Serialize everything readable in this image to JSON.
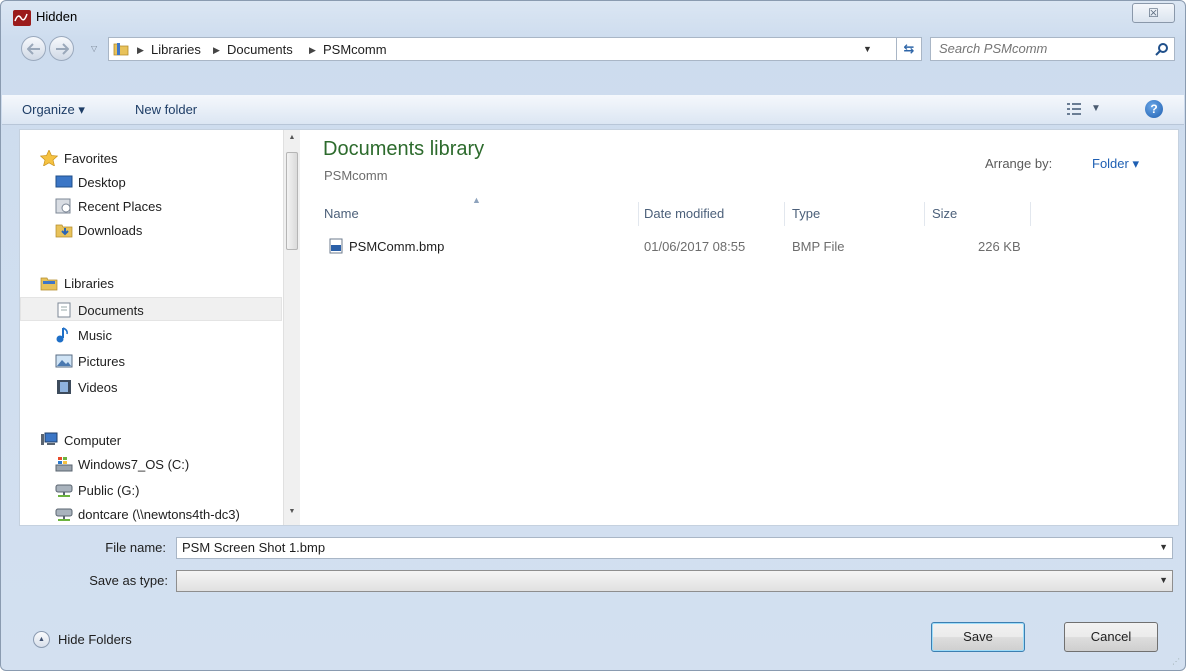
{
  "window": {
    "title": "Hidden",
    "close_glyph": "☒"
  },
  "address": {
    "crumbs": [
      "Libraries",
      "Documents",
      "PSMcomm"
    ]
  },
  "search": {
    "placeholder": "Search PSMcomm"
  },
  "toolbar": {
    "organize": "Organize ▾",
    "new_folder": "New folder",
    "help": "?"
  },
  "nav": {
    "favorites": "Favorites",
    "desktop": "Desktop",
    "recent_places": "Recent Places",
    "downloads": "Downloads",
    "libraries": "Libraries",
    "documents": "Documents",
    "music": "Music",
    "pictures": "Pictures",
    "videos": "Videos",
    "computer": "Computer",
    "windows_os": "Windows7_OS (C:)",
    "public": "Public (G:)",
    "dontcare": "dontcare (\\\\newtons4th-dc3)"
  },
  "content": {
    "library_title": "Documents library",
    "library_sub": "PSMcomm",
    "arrange_label": "Arrange by:",
    "arrange_value": "Folder ▾",
    "columns": {
      "name": "Name",
      "date": "Date modified",
      "type": "Type",
      "size": "Size"
    },
    "files": [
      {
        "name": "PSMComm.bmp",
        "date": "01/06/2017 08:55",
        "type": "BMP File",
        "size": "226 KB"
      }
    ]
  },
  "bottom": {
    "file_name_label": "File name:",
    "file_name_value": "PSM Screen Shot 1.bmp",
    "save_type_label": "Save as type:",
    "save_type_value": "",
    "hide_folders": "Hide Folders",
    "save": "Save",
    "cancel": "Cancel"
  },
  "colors": {
    "library_title": "#2d6b2d",
    "link_blue": "#1e5fb3",
    "selected_bg": "#f0f0f0"
  }
}
